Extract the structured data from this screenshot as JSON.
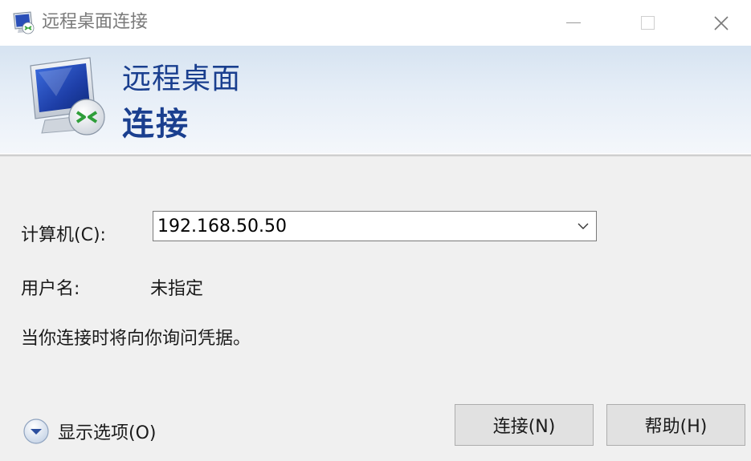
{
  "window": {
    "title": "远程桌面连接"
  },
  "banner": {
    "title_line1": "远程桌面",
    "title_line2": "连接"
  },
  "form": {
    "computer_label": "计算机(C):",
    "computer_value": "192.168.50.50",
    "user_label": "用户名:",
    "user_value": "未指定",
    "credential_note": "当你连接时将向你询问凭据。"
  },
  "options": {
    "label": "显示选项(O)"
  },
  "buttons": {
    "connect_label": "连接(N)",
    "help_label": "帮助(H)"
  },
  "icons": {
    "app": "remote-desktop-icon",
    "minimize": "minimize-icon",
    "maximize": "maximize-icon",
    "close": "close-icon",
    "dropdown": "chevron-down-icon",
    "expand": "expand-circle-icon"
  },
  "colors": {
    "banner_title": "#1a3f8f",
    "button_bg": "#e1e1e1"
  }
}
